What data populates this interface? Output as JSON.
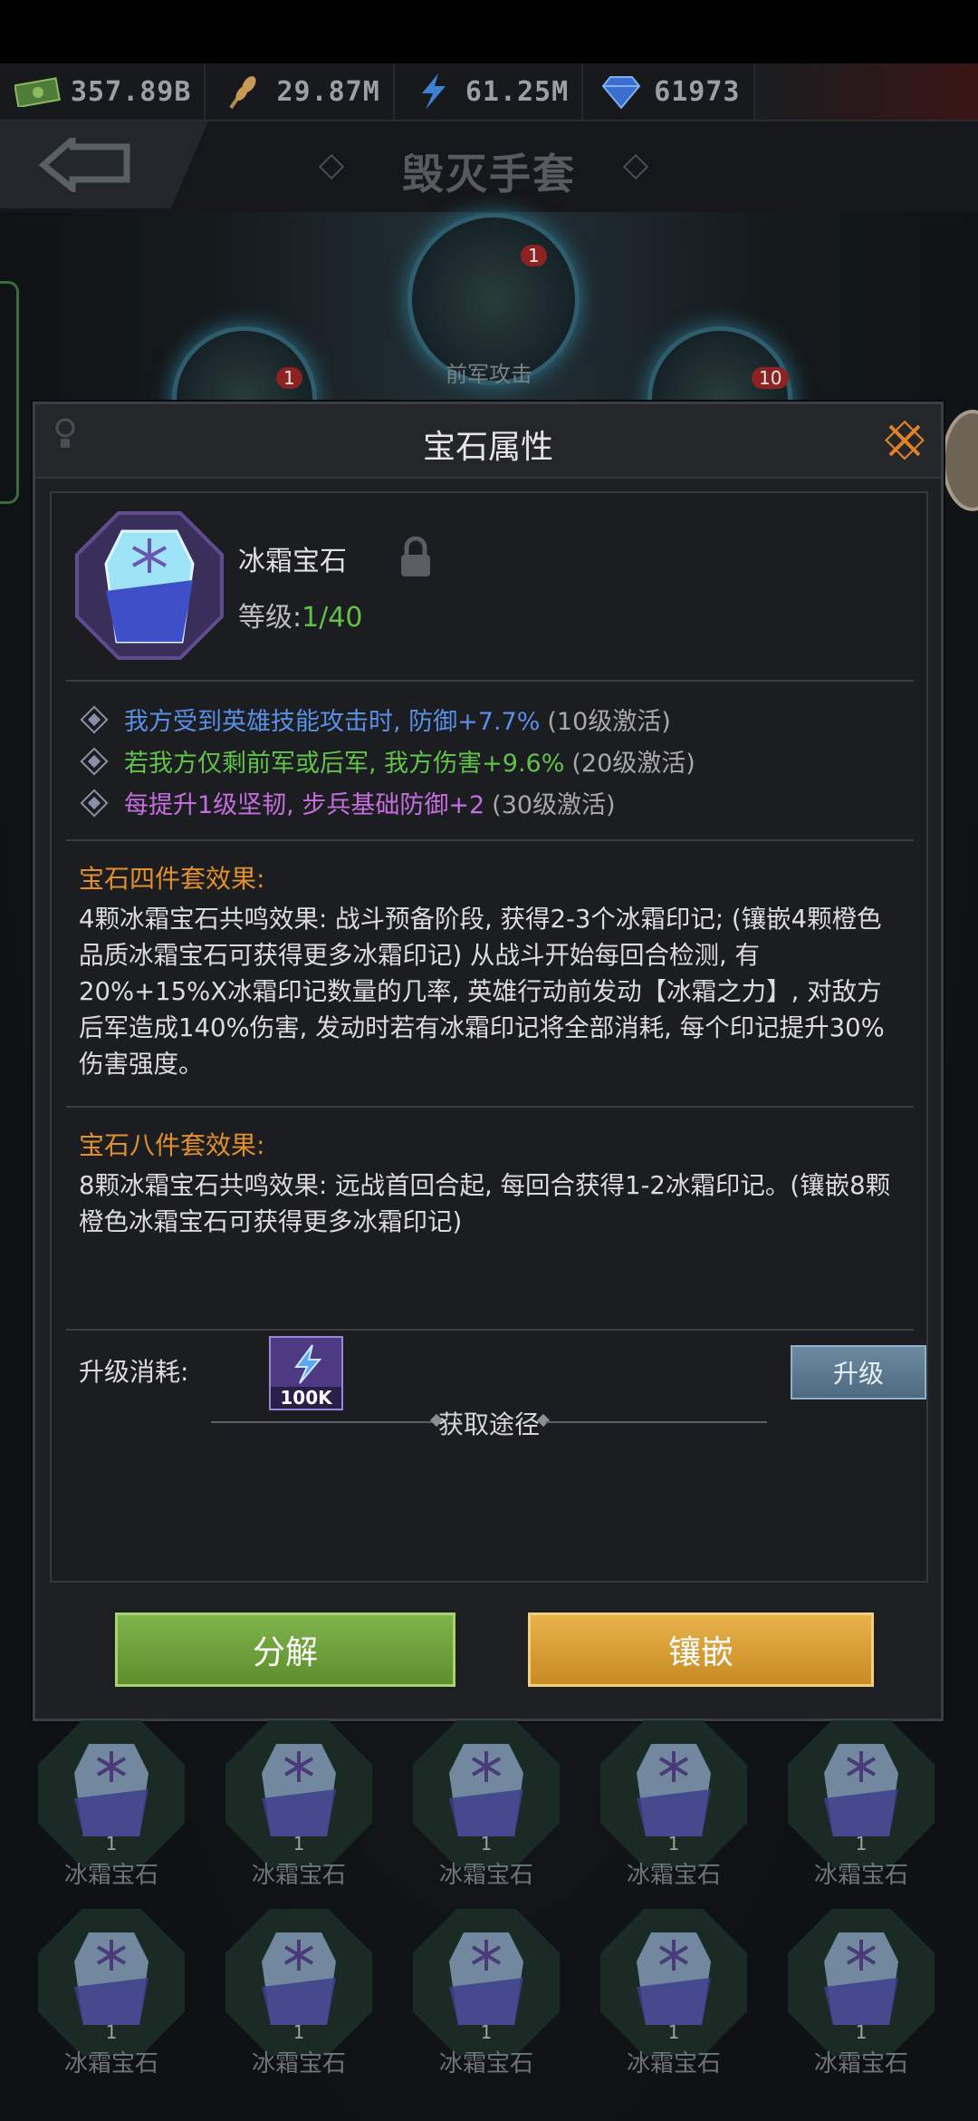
{
  "resources": [
    {
      "icon": "cash-icon",
      "value": "357.89B"
    },
    {
      "icon": "wheat-icon",
      "value": "29.87M"
    },
    {
      "icon": "lightning-icon",
      "value": "61.25M"
    },
    {
      "icon": "diamond-icon",
      "value": "61973"
    }
  ],
  "header": {
    "title": "毁灭手套"
  },
  "nodes": [
    {
      "badge": "1",
      "label": "前军攻击"
    },
    {
      "badge": "1"
    },
    {
      "badge": "10"
    }
  ],
  "dialog": {
    "title": "宝石属性",
    "gem": {
      "name": "冰霜宝石",
      "level_label": "等级:",
      "level_value": "1/40"
    },
    "attributes": [
      {
        "text": "我方受到英雄技能攻击时, 防御+7.7%",
        "suffix": "(10级激活)",
        "color": "#5a8fe6"
      },
      {
        "text": "若我方仅剩前军或后军, 我方伤害+9.6%",
        "suffix": "(20级激活)",
        "color": "#62c24a"
      },
      {
        "text": "每提升1级坚韧, 步兵基础防御+2",
        "suffix": "(30级激活)",
        "color": "#c66ee0"
      }
    ],
    "set4": {
      "title": "宝石四件套效果:",
      "body": "4颗冰霜宝石共鸣效果: 战斗预备阶段, 获得2-3个冰霜印记; (镶嵌4颗橙色品质冰霜宝石可获得更多冰霜印记) 从战斗开始每回合检测, 有20%+15%X冰霜印记数量的几率, 英雄行动前发动【冰霜之力】, 对敌方后军造成140%伤害, 发动时若有冰霜印记将全部消耗, 每个印记提升30%伤害强度。"
    },
    "set8": {
      "title": "宝石八件套效果:",
      "body": "8颗冰霜宝石共鸣效果: 远战首回合起, 每回合获得1-2冰霜印记。(镶嵌8颗橙色冰霜宝石可获得更多冰霜印记)"
    },
    "upgrade": {
      "label": "升级消耗:",
      "cost": "100K",
      "button": "升级"
    },
    "acquire_label": "获取途径",
    "decompose_button": "分解",
    "inlay_button": "镶嵌"
  },
  "inventory": [
    {
      "count": "1",
      "name": "冰霜宝石"
    },
    {
      "count": "1",
      "name": "冰霜宝石"
    },
    {
      "count": "1",
      "name": "冰霜宝石"
    },
    {
      "count": "1",
      "name": "冰霜宝石"
    },
    {
      "count": "1",
      "name": "冰霜宝石"
    },
    {
      "count": "1",
      "name": "冰霜宝石"
    },
    {
      "count": "1",
      "name": "冰霜宝石"
    },
    {
      "count": "1",
      "name": "冰霜宝石"
    },
    {
      "count": "1",
      "name": "冰霜宝石"
    },
    {
      "count": "1",
      "name": "冰霜宝石"
    }
  ]
}
